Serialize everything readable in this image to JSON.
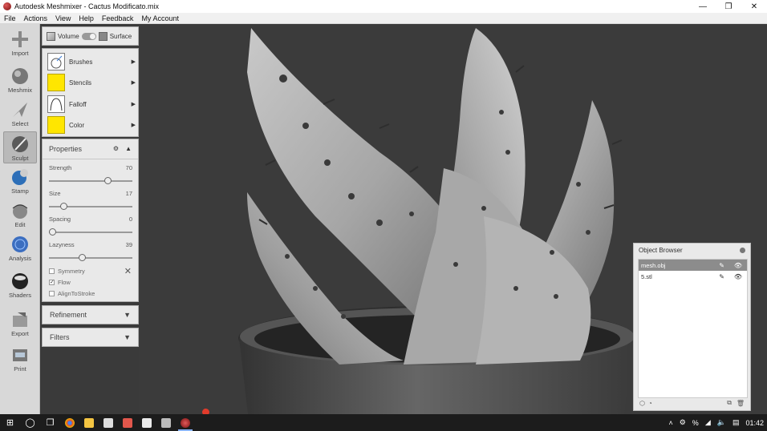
{
  "titlebar": {
    "title": "Autodesk Meshmixer - Cactus Modificato.mix",
    "minimize": "—",
    "maximize": "❐",
    "close": "✕"
  },
  "menu": [
    "File",
    "Actions",
    "View",
    "Help",
    "Feedback",
    "My Account"
  ],
  "tools": [
    {
      "label": "Import",
      "icon": "import-icon"
    },
    {
      "label": "Meshmix",
      "icon": "meshmix-icon"
    },
    {
      "label": "Select",
      "icon": "select-icon"
    },
    {
      "label": "Sculpt",
      "icon": "sculpt-icon",
      "active": true
    },
    {
      "label": "Stamp",
      "icon": "stamp-icon"
    },
    {
      "label": "Edit",
      "icon": "edit-icon"
    },
    {
      "label": "Analysis",
      "icon": "analysis-icon"
    },
    {
      "label": "Shaders",
      "icon": "shaders-icon"
    },
    {
      "label": "Export",
      "icon": "export-icon"
    },
    {
      "label": "Print",
      "icon": "print-icon"
    }
  ],
  "mode": {
    "volume": "Volume",
    "surface": "Surface"
  },
  "brushes": [
    {
      "label": "Brushes",
      "swatch": "#ffffff"
    },
    {
      "label": "Stencils",
      "swatch": "#ffe600"
    },
    {
      "label": "Falloff",
      "swatch": "#ffffff"
    },
    {
      "label": "Color",
      "swatch": "#ffe600"
    }
  ],
  "properties": {
    "title": "Properties",
    "sliders": [
      {
        "label": "Strength",
        "value": "70",
        "pos": 0.7
      },
      {
        "label": "Size",
        "value": "17",
        "pos": 0.17
      },
      {
        "label": "Spacing",
        "value": "0",
        "pos": 0.0
      },
      {
        "label": "Lazyness",
        "value": "39",
        "pos": 0.39
      }
    ],
    "checks": [
      {
        "label": "Symmetry",
        "checked": false
      },
      {
        "label": "Flow",
        "checked": true
      },
      {
        "label": "AlignToStroke",
        "checked": false
      }
    ]
  },
  "refinement": "Refinement",
  "filters": "Filters",
  "object_browser": {
    "title": "Object Browser",
    "items": [
      {
        "name": "mesh.obj",
        "selected": true
      },
      {
        "name": "5.stl",
        "selected": false
      }
    ]
  },
  "taskbar": {
    "clock": "01:42",
    "lang": "%"
  },
  "colors": {
    "accent": "#ffe600",
    "viewport": "#3b3b3b"
  }
}
